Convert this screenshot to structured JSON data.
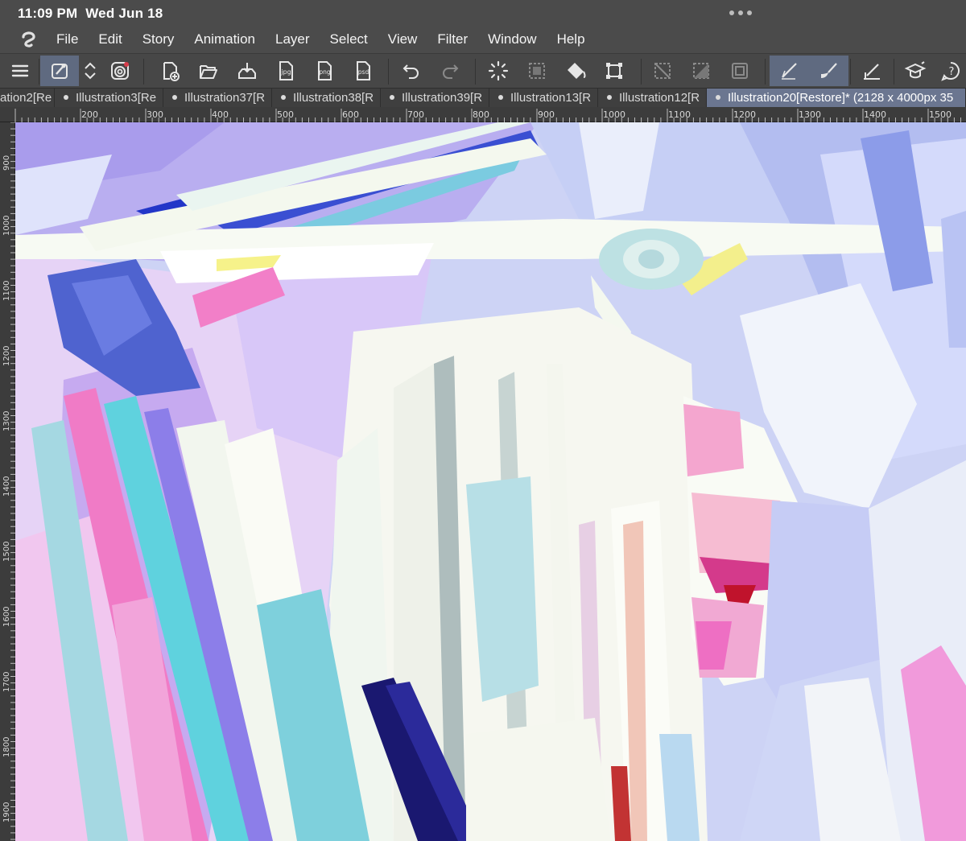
{
  "status_bar": {
    "time": "11:09 PM",
    "date": "Wed Jun 18"
  },
  "menu": {
    "items": [
      "File",
      "Edit",
      "Story",
      "Animation",
      "Layer",
      "Select",
      "View",
      "Filter",
      "Window",
      "Help"
    ]
  },
  "toolbar": {
    "icons": [
      "menu-icon",
      "sub-tool-icon",
      "up-down-arrows-icon",
      "color-wheel-icon",
      "new-file-icon",
      "open-folder-icon",
      "save-icon",
      "export-jpg-icon",
      "export-png-icon",
      "export-psd-icon",
      "undo-icon",
      "redo-icon",
      "loading-icon",
      "select-transform-icon",
      "fill-bucket-icon",
      "transform-icon",
      "deselect-icon",
      "invert-selection-icon",
      "crop-selection-icon",
      "pen-tool-icon",
      "brush-tool-icon",
      "ruler-pen-icon",
      "learn-icon",
      "help-icon"
    ],
    "file_labels": {
      "jpg": "jpg",
      "png": "png",
      "psd": "psd"
    }
  },
  "tabs": [
    {
      "label": "ation2[Re",
      "active": false,
      "dot": false
    },
    {
      "label": "Illustration3[Re",
      "active": false,
      "dot": true
    },
    {
      "label": "Illustration37[R",
      "active": false,
      "dot": true
    },
    {
      "label": "Illustration38[R",
      "active": false,
      "dot": true
    },
    {
      "label": "Illustration39[R",
      "active": false,
      "dot": true
    },
    {
      "label": "Illustration13[R",
      "active": false,
      "dot": true
    },
    {
      "label": "Illustration12[R",
      "active": false,
      "dot": true
    },
    {
      "label": "Illustration20[Restore]* (2128 x 4000px 35",
      "active": true,
      "dot": true
    }
  ],
  "ruler": {
    "horizontal": [
      "200",
      "300",
      "400",
      "500",
      "600",
      "700",
      "800",
      "900",
      "1000",
      "1100",
      "1200",
      "1300",
      "1400",
      "1500"
    ],
    "vertical": [
      "900",
      "1000",
      "1100",
      "1200",
      "1300",
      "1400",
      "1500",
      "1600",
      "1700",
      "1800",
      "1900"
    ]
  },
  "colors": {
    "chrome": "#4b4b4b",
    "active_accent": "#6b7690",
    "canvas_base": "#cdd3f5"
  }
}
